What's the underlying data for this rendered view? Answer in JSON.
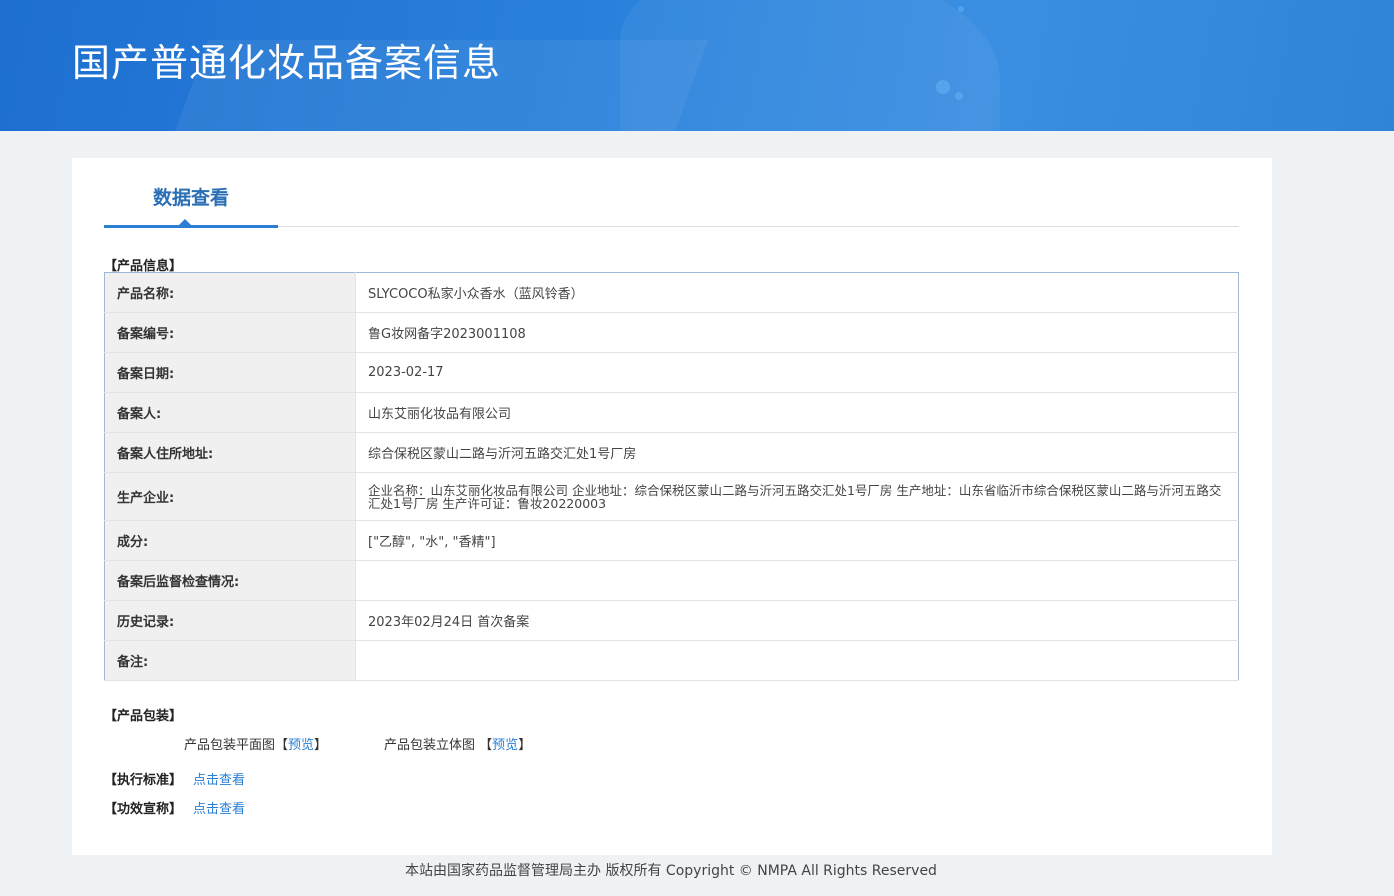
{
  "header": {
    "title": "国产普通化妆品备案信息"
  },
  "tab": {
    "label": "数据查看"
  },
  "product_info": {
    "section_title": "【产品信息】",
    "rows": [
      {
        "key": "产品名称:",
        "value": "SLYCOCO私家小众香水（蓝风铃香）"
      },
      {
        "key": "备案编号:",
        "value": "鲁G妆网备字2023001108"
      },
      {
        "key": "备案日期:",
        "value": "2023-02-17"
      },
      {
        "key": "备案人:",
        "value": "山东艾丽化妆品有限公司"
      },
      {
        "key": "备案人住所地址:",
        "value": "综合保税区蒙山二路与沂河五路交汇处1号厂房"
      },
      {
        "key": "生产企业:",
        "value": "企业名称：山东艾丽化妆品有限公司 企业地址：综合保税区蒙山二路与沂河五路交汇处1号厂房 生产地址：山东省临沂市综合保税区蒙山二路与沂河五路交汇处1号厂房 生产许可证：鲁妆20220003"
      },
      {
        "key": "成分:",
        "value": "[\"乙醇\", \"水\", \"香精\"]"
      },
      {
        "key": "备案后监督检查情况:",
        "value": ""
      },
      {
        "key": "历史记录:",
        "value": "2023年02月24日 首次备案"
      },
      {
        "key": "备注:",
        "value": ""
      }
    ]
  },
  "packaging": {
    "section_title": "【产品包装】",
    "flat_label": "产品包装平面图",
    "flat_link": "预览",
    "solid_label": "产品包装立体图",
    "solid_link": "预览"
  },
  "standard": {
    "section_title": "【执行标准】",
    "link": "点击查看"
  },
  "efficacy": {
    "section_title": "【功效宣称】",
    "link": "点击查看"
  },
  "footer": {
    "text": "本站由国家药品监督管理局主办 版权所有 Copyright © NMPA All Rights Reserved"
  }
}
